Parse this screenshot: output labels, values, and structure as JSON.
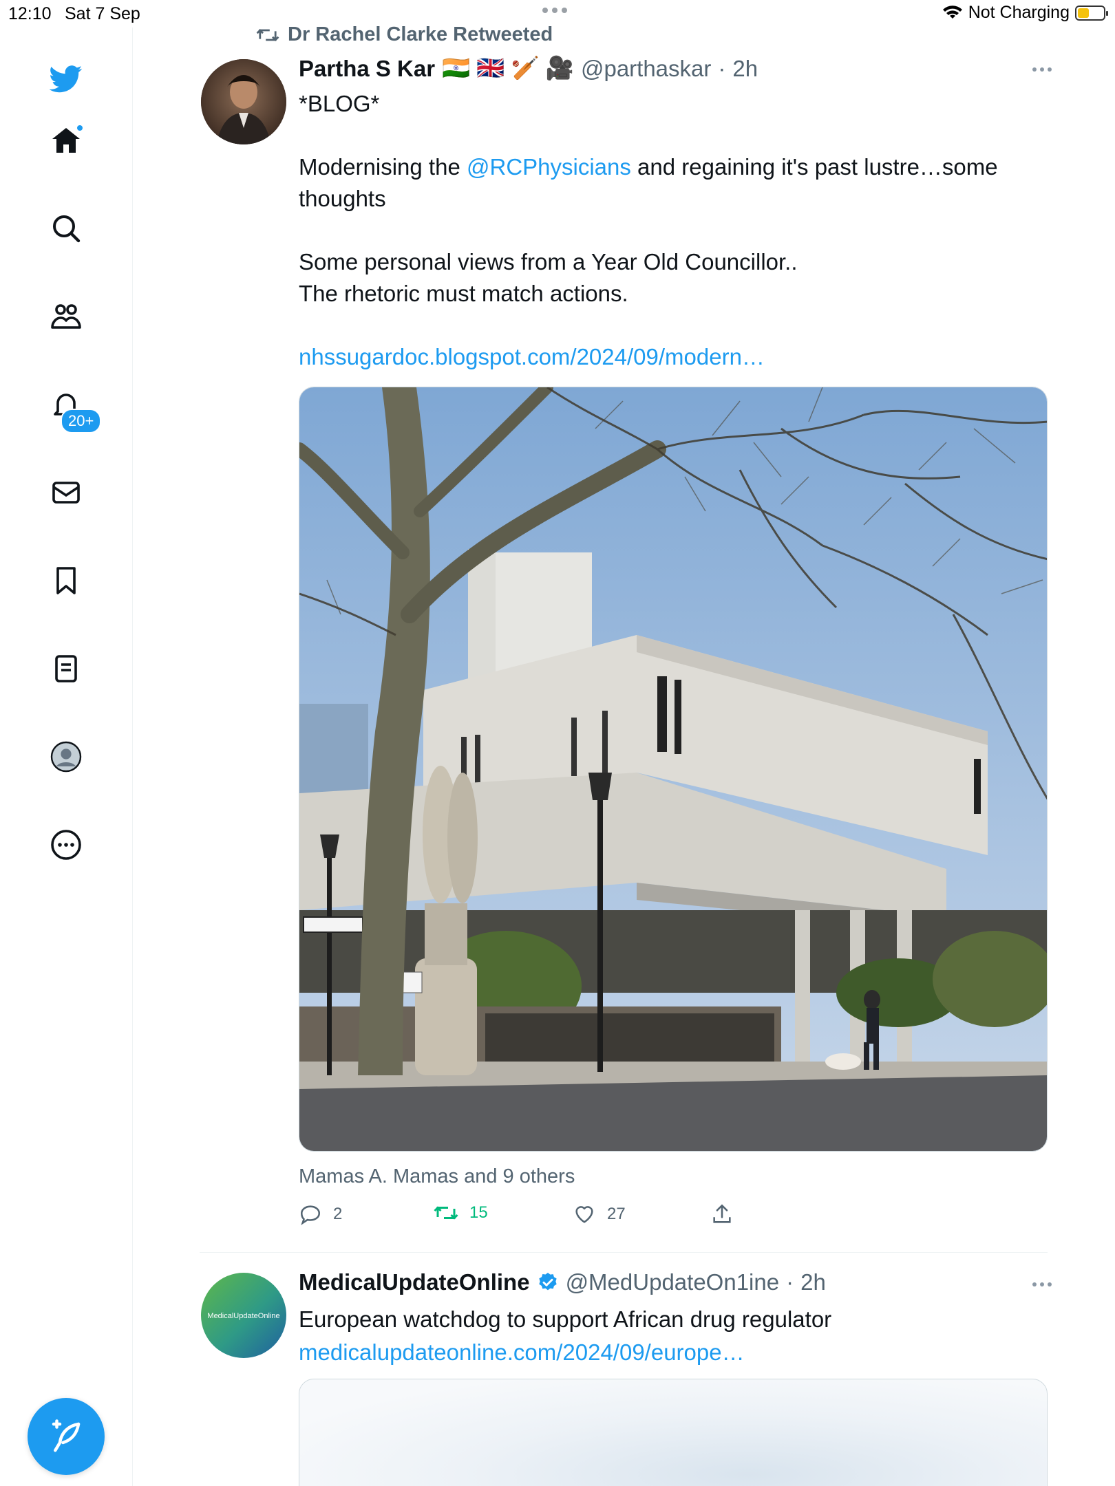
{
  "status_bar": {
    "time": "12:10",
    "date": "Sat 7 Sep",
    "battery_status": "Not Charging"
  },
  "sidebar": {
    "items": [
      {
        "icon": "twitter-bird-icon"
      },
      {
        "icon": "home-icon"
      },
      {
        "icon": "search-icon"
      },
      {
        "icon": "communities-icon"
      },
      {
        "icon": "bell-icon"
      },
      {
        "icon": "mail-icon"
      },
      {
        "icon": "bookmark-icon"
      },
      {
        "icon": "lists-icon"
      },
      {
        "icon": "profile-icon"
      },
      {
        "icon": "more-circle-icon"
      }
    ],
    "notifications_badge": "20+",
    "compose_icon": "compose-feather-icon"
  },
  "colors": {
    "accent": "#1d9bf0",
    "retweet_green": "#00ba7c",
    "secondary_text": "#536471"
  },
  "tweet1": {
    "retweeted_by": "Dr Rachel Clarke Retweeted",
    "author_name": "Partha S Kar",
    "author_emojis": "🇮🇳 🇬🇧 🏏 🎥",
    "handle": "@parthaskar",
    "separator": "·",
    "time": "2h",
    "line1": "*BLOG*",
    "line2_prefix": "Modernising the ",
    "line2_mention": "@RCPhysicians",
    "line2_suffix": " and regaining it's past lustre…some thoughts",
    "line3": "Some personal views from a Year Old Councillor..",
    "line4": "The rhetoric must match actions.",
    "link": "nhssugardoc.blogspot.com/2024/09/modern…",
    "liked_by": "Mamas A. Mamas and 9 others",
    "replies": "2",
    "retweets": "15",
    "likes": "27"
  },
  "tweet2": {
    "author_name": "MedicalUpdateOnline",
    "handle": "@MedUpdateOn1ine",
    "separator": "·",
    "time": "2h",
    "avatar_text": "MedicalUpdateOnline",
    "text": "European watchdog to support African drug regulator",
    "link": "medicalupdateonline.com/2024/09/europe…"
  }
}
